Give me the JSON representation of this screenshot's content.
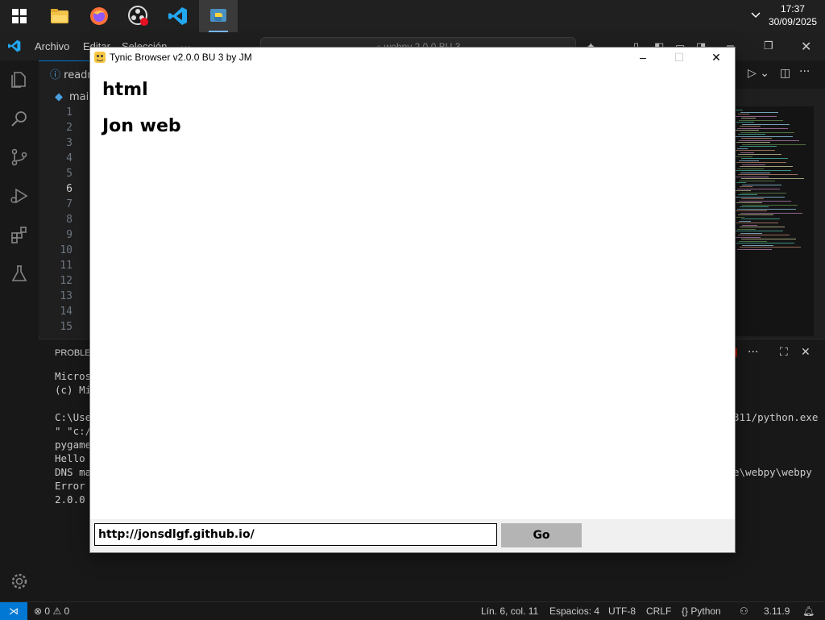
{
  "taskbar": {
    "clock_time": "17:37",
    "clock_date": "30/09/2025",
    "apps": [
      "windows-start",
      "file-explorer",
      "firefox",
      "obs",
      "vscode",
      "python"
    ]
  },
  "vscode": {
    "menu": [
      "Archivo",
      "Editar",
      "Selección",
      "···"
    ],
    "command_center": "webpy 2.0.0 BU 3",
    "tab_label": "readm",
    "breadcrumb": "main",
    "line_numbers": [
      "1",
      "2",
      "3",
      "4",
      "5",
      "6",
      "7",
      "8",
      "9",
      "10",
      "11",
      "12",
      "13",
      "14",
      "15"
    ],
    "current_line": "6",
    "panel_tab": "PROBLEM",
    "terminal_left": [
      "Micros",
      "(c) Mi",
      "",
      "C:\\Use",
      "\" \"c:/",
      "pygame",
      "Hello ",
      "DNS ma",
      "Error ",
      "2.0.0 "
    ],
    "terminal_right": [
      "311/python.exe",
      "",
      "",
      "",
      "e\\webpy\\webpy"
    ],
    "status": {
      "errors": "0",
      "warnings": "0",
      "position": "Lín. 6, col. 11",
      "spaces": "Espacios: 4",
      "encoding": "UTF-8",
      "eol": "CRLF",
      "language": "Python",
      "version": "3.11.9"
    }
  },
  "browser": {
    "title": "Tynic Browser v2.0.0 BU 3 by JM",
    "heading1": "html",
    "heading2": "Jon web",
    "url": "http://jonsdlgf.github.io/",
    "go_label": "Go"
  }
}
